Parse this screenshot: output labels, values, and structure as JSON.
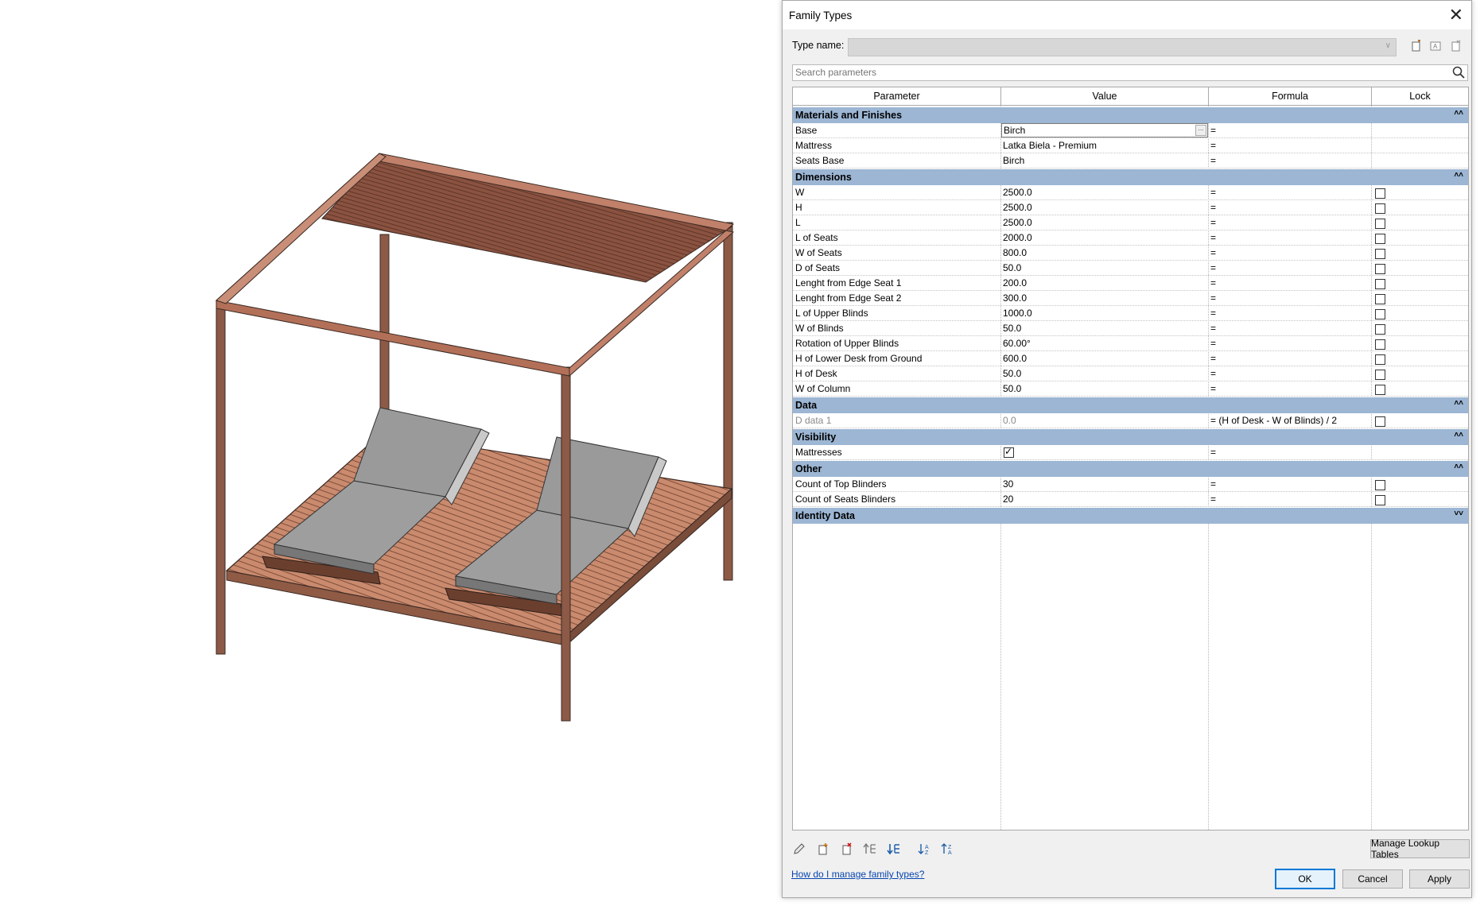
{
  "dialog": {
    "title": "Family Types",
    "type_name_label": "Type name:",
    "type_name_value": "",
    "search_placeholder": "Search parameters",
    "columns": [
      "Parameter",
      "Value",
      "Formula",
      "Lock"
    ],
    "groups": [
      {
        "label": "Materials and Finishes",
        "chevron": "collapse",
        "rows": [
          {
            "name": "Base",
            "value": "Birch",
            "formula": "=",
            "lock": null,
            "editing": true
          },
          {
            "name": "Mattress",
            "value": "Latka Biela - Premium",
            "formula": "=",
            "lock": null
          },
          {
            "name": "Seats Base",
            "value": "Birch",
            "formula": "=",
            "lock": null
          }
        ]
      },
      {
        "label": "Dimensions",
        "chevron": "collapse",
        "rows": [
          {
            "name": "W",
            "value": "2500.0",
            "formula": "=",
            "lock": false
          },
          {
            "name": "H",
            "value": "2500.0",
            "formula": "=",
            "lock": false
          },
          {
            "name": "L",
            "value": "2500.0",
            "formula": "=",
            "lock": false
          },
          {
            "name": "L of Seats",
            "value": "2000.0",
            "formula": "=",
            "lock": false
          },
          {
            "name": "W of Seats",
            "value": "800.0",
            "formula": "=",
            "lock": false
          },
          {
            "name": "D of Seats",
            "value": "50.0",
            "formula": "=",
            "lock": false
          },
          {
            "name": "Lenght from Edge Seat 1",
            "value": "200.0",
            "formula": "=",
            "lock": false
          },
          {
            "name": "Lenght from Edge Seat 2",
            "value": "300.0",
            "formula": "=",
            "lock": false
          },
          {
            "name": "L of Upper Blinds",
            "value": "1000.0",
            "formula": "=",
            "lock": false
          },
          {
            "name": "W of Blinds",
            "value": "50.0",
            "formula": "=",
            "lock": false
          },
          {
            "name": "Rotation of Upper Blinds",
            "value": "60.00°",
            "formula": "=",
            "lock": false
          },
          {
            "name": "H of Lower Desk from Ground",
            "value": "600.0",
            "formula": "=",
            "lock": false
          },
          {
            "name": "H of Desk",
            "value": "50.0",
            "formula": "=",
            "lock": false
          },
          {
            "name": "W of Column",
            "value": "50.0",
            "formula": "=",
            "lock": false
          }
        ]
      },
      {
        "label": "Data",
        "chevron": "collapse",
        "rows": [
          {
            "name": "D data 1",
            "value": "0.0",
            "formula": "= (H of Desk - W of Blinds) / 2",
            "lock": false,
            "disabled": true
          }
        ]
      },
      {
        "label": "Visibility",
        "chevron": "collapse",
        "rows": [
          {
            "name": "Mattresses",
            "value": "",
            "checkbox": true,
            "formula": "=",
            "lock": null
          }
        ]
      },
      {
        "label": "Other",
        "chevron": "collapse",
        "rows": [
          {
            "name": "Count of Top Blinders",
            "value": "30",
            "formula": "=",
            "lock": false
          },
          {
            "name": "Count of Seats Blinders",
            "value": "20",
            "formula": "=",
            "lock": false
          }
        ]
      },
      {
        "label": "Identity Data",
        "chevron": "expand",
        "rows": []
      }
    ],
    "chevrons": {
      "collapse": "˄˄",
      "expand": "˅˅"
    },
    "manage_lookup_label": "Manage Lookup Tables",
    "help_link": "How do I manage family types?",
    "ok_label": "OK",
    "cancel_label": "Cancel",
    "apply_label": "Apply",
    "colors": {
      "group_header": "#9cb6d4",
      "link": "#0645ad",
      "wood": "#b37058",
      "cushion": "#a8a8a8"
    }
  }
}
